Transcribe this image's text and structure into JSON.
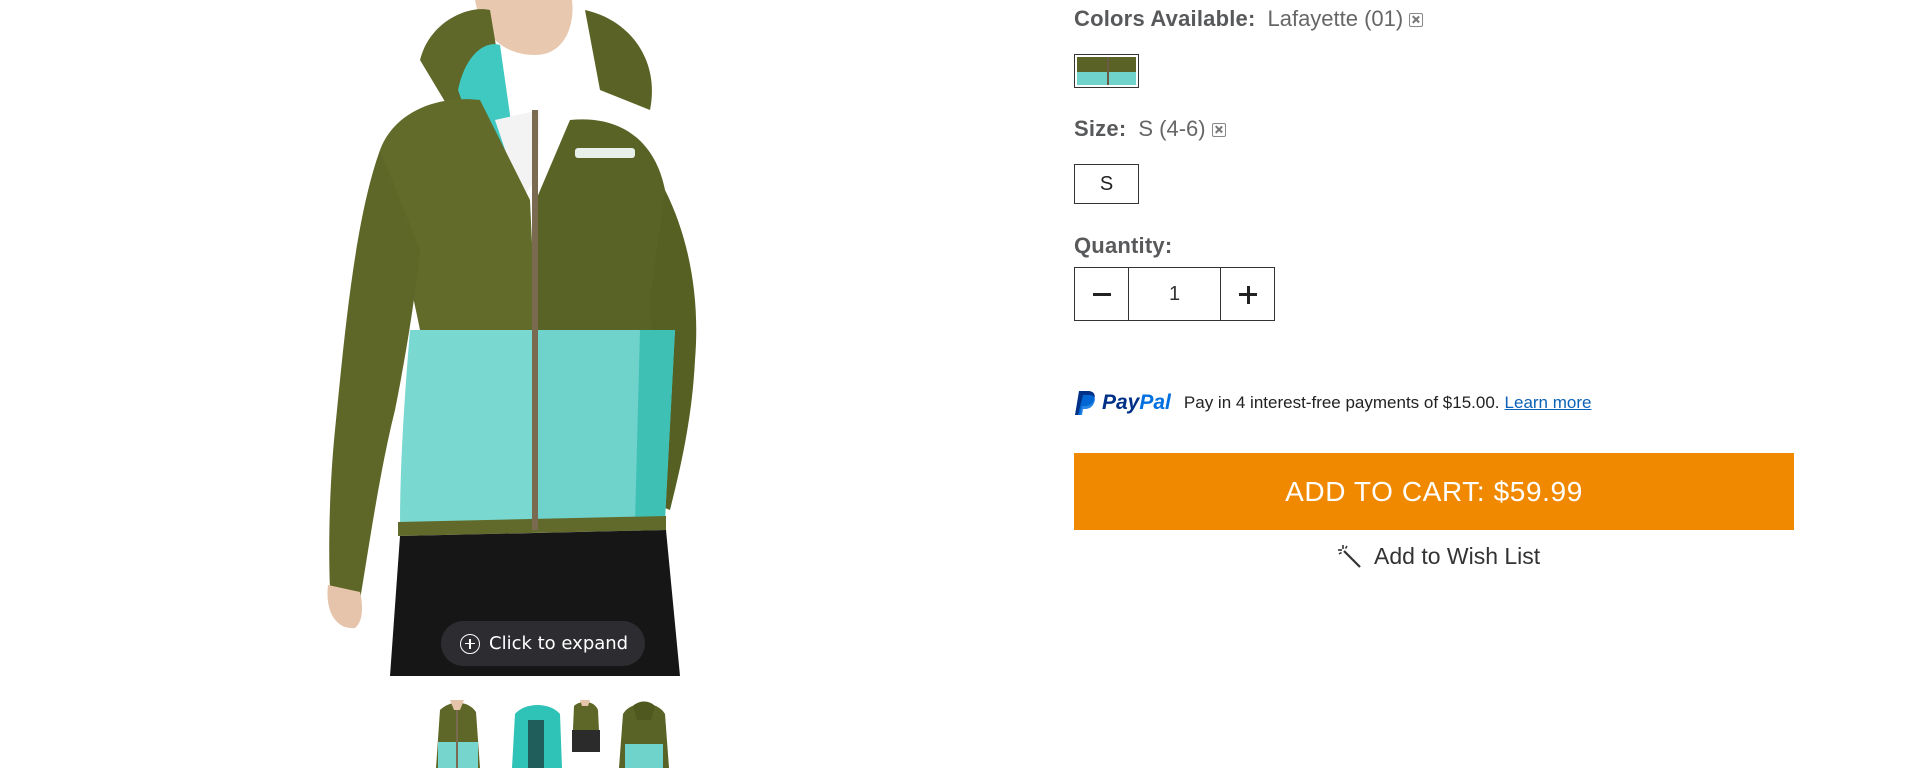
{
  "product_media": {
    "expand_label": "Click to expand",
    "thumbnails": [
      {
        "icon": "jacket-front-thumbnail"
      },
      {
        "icon": "jacket-open-thumbnail"
      },
      {
        "icon": "jacket-back-thumbnail"
      }
    ]
  },
  "options": {
    "colors_label": "Colors Available:",
    "selected_color": "Lafayette (01)",
    "size_label": "Size:",
    "selected_size": "S (4-6)",
    "size_options": [
      "S"
    ],
    "quantity_label": "Quantity:",
    "quantity_value": "1"
  },
  "paypal": {
    "brand": "PayPal",
    "message": "Pay in 4 interest-free payments of $15.00.",
    "learn_more": "Learn more"
  },
  "actions": {
    "add_to_cart": "ADD TO CART: $59.99",
    "wish_list": "Add to Wish List"
  },
  "colors": {
    "cart_button": "#f08900",
    "jacket_olive": "#5b6226",
    "jacket_aqua": "#6fd3cc",
    "paypal_blue": "#003087"
  }
}
